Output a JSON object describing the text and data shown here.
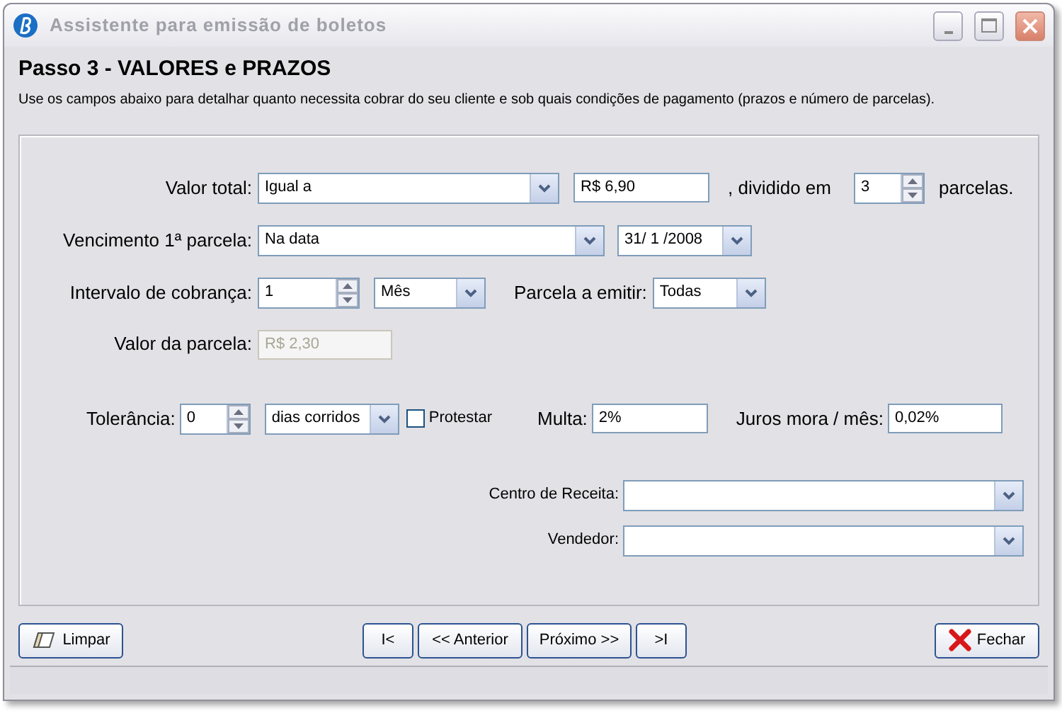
{
  "window": {
    "title": "Assistente para emissão de boletos",
    "active": false
  },
  "heading": "Passo 3 - VALORES e PRAZOS",
  "description": "Use os campos abaixo para detalhar quanto necessita cobrar do seu cliente e sob quais condições de pagamento (prazos e número de parcelas).",
  "valor_total": {
    "label": "Valor total:",
    "mode": "Igual a",
    "amount": "R$ 6,90",
    "divided_label": ", dividido em",
    "parcelas": "3",
    "parcelas_label": "parcelas."
  },
  "vencimento": {
    "label": "Vencimento 1ª parcela:",
    "mode": "Na data",
    "date": "31/ 1 /2008"
  },
  "intervalo": {
    "label": "Intervalo de cobrança:",
    "value": "1",
    "unit": "Mês",
    "parcela_label": "Parcela a emitir:",
    "parcela": "Todas"
  },
  "valor_parcela": {
    "label": "Valor da parcela:",
    "value": "R$ 2,30",
    "disabled": true
  },
  "tolerancia": {
    "label": "Tolerância:",
    "value": "0",
    "unit": "dias corridos",
    "protestar_label": "Protestar",
    "protestar_checked": false,
    "multa_label": "Multa:",
    "multa": "2%",
    "juros_label": "Juros mora / mês:",
    "juros": "0,02%"
  },
  "centro": {
    "label": "Centro de Receita:"
  },
  "vendedor": {
    "label": "Vendedor:"
  },
  "buttons": [
    {
      "kind": "clear",
      "label": "Limpar"
    },
    {
      "kind": "first",
      "label": "I<"
    },
    {
      "kind": "prev",
      "label": "<< Anterior"
    },
    {
      "kind": "next",
      "label": "Próximo >>"
    },
    {
      "kind": "last",
      "label": ">I"
    },
    {
      "kind": "close",
      "label": "Fechar"
    }
  ]
}
